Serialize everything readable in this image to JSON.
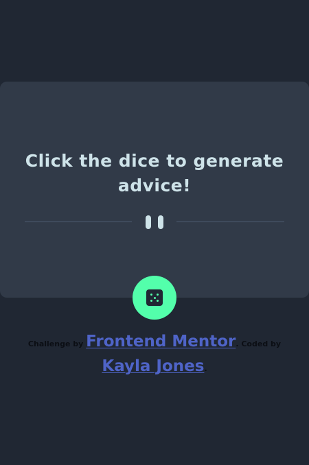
{
  "advice": {
    "text": "Click the dice to generate advice!"
  },
  "divider": {
    "icon": "pause-icon"
  },
  "dice_button": {
    "icon": "dice-icon"
  },
  "attribution": {
    "prefix": "Challenge by",
    "challenge_link": "Frontend Mentor",
    "middle": ". Coded by",
    "author_link": "Kayla Jones",
    "suffix": "."
  },
  "colors": {
    "background": "#202733",
    "card": "#313a48",
    "text": "#cee3e9",
    "accent": "#53ffab",
    "divider": "#4f5d74",
    "link": "#4f64c8"
  }
}
